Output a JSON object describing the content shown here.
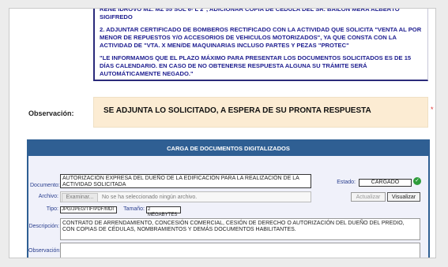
{
  "notice": {
    "line1": "RENE IDROVO MZ. MZ 55 SOL 6- L 2\", ADICIONAR COPIA DE CEDULA DEL SR. BAILON MERA ALBERTO SIGIFREDO",
    "line2": "2. ADJUNTAR CERTIFICADO DE BOMBEROS RECTIFICADO CON LA ACTIVIDAD QUE SOLICITA \"VENTA AL POR MENOR DE REPUESTOS Y/O ACCESORIOS DE VEHICULOS MOTORIZADOS\", YA QUE CONSTA CON LA ACTIVIDAD DE \"VTA. X MEN/DE MAQUINARIAS INCLUSO PARTES Y PEZAS \"PROTEC\"",
    "line3": "\"LE INFORMAMOS QUE EL PLAZO MÁXIMO PARA PRESENTAR LOS DOCUMENTOS SOLICITADOS ES DE 15 DÍAS CALENDARIO. EN CASO DE NO OBTENERSE RESPUESTA ALGUNA SU TRÁMITE SERÁ AUTOMÁTICAMENTE NEGADO.\""
  },
  "observation": {
    "label": "Observación:",
    "text": "SE ADJUNTA LO SOLICITADO, A ESPERA DE SU PRONTA RESPUESTA",
    "required_mark": "*"
  },
  "upload_panel": {
    "title": "CARGA DE DOCUMENTOS DIGITALIZADOS",
    "documento_label": "Documento:",
    "documento_value": "AUTORIZACIÓN EXPRESA DEL DUEÑO DE LA EDIFICACIÓN PARA LA REALIZACIÓN DE LA ACTIVIDAD SOLICITADA",
    "estado_label": "Estado:",
    "estado_value": "CARGADO",
    "archivo_label": "Archivo:",
    "browse_button": "Examinar...",
    "no_file_text": "No se ha seleccionado ningún archivo.",
    "actualizar_button": "Actualizar",
    "visualizar_button": "Visualizar",
    "tipo_label": "Tipo:",
    "tipo_value": "JPG/JPEG/TIF/PDF/MDI",
    "tamano_label": "Tamaño:",
    "tamano_value": "2 MEGABYTES",
    "descripcion_label": "Descripción:",
    "descripcion_value": "CONTRATO DE ARRENDAMIENTO, CONCESIÓN COMERCIAL, CESIÓN DE DERECHO O AUTORIZACIÓN DEL DUEÑO DEL PREDIO, CON COPIAS DE CÉDULAS, NOMBRAMIENTOS Y DEMÁS DOCUMENTOS HABILITANTES.",
    "observacion_label": "Observación:",
    "status_icon": "check-circle-icon"
  },
  "colors": {
    "notice_text": "#1d1d8f",
    "panel_header": "#2f5f93",
    "observation_bg": "#fcecd3",
    "status_ok": "#2e9c3a"
  }
}
